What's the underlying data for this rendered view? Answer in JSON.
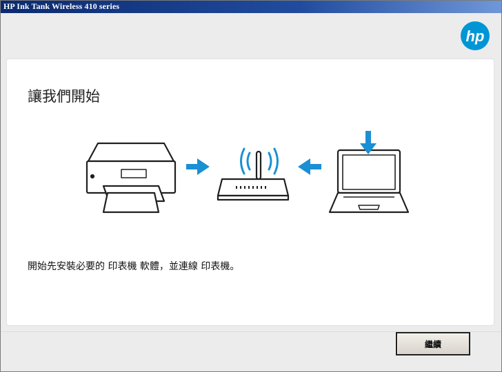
{
  "window": {
    "title": "HP Ink Tank Wireless 410 series"
  },
  "logo": {
    "text": "hp",
    "color": "#0096d6"
  },
  "content": {
    "heading": "讓我們開始",
    "description": "開始先安裝必要的 印表機 軟體，並連線 印表機。"
  },
  "illustration": {
    "icons": [
      "printer-icon",
      "wifi-router-icon",
      "laptop-icon"
    ],
    "arrow_color": "#1b8fd3"
  },
  "footer": {
    "continue_label": "繼續"
  }
}
